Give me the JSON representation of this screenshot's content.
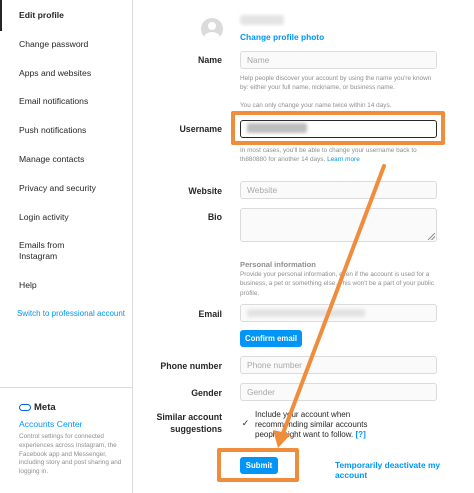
{
  "sidebar": {
    "items": [
      {
        "label": "Edit profile"
      },
      {
        "label": "Change password"
      },
      {
        "label": "Apps and websites"
      },
      {
        "label": "Email notifications"
      },
      {
        "label": "Push notifications"
      },
      {
        "label": "Manage contacts"
      },
      {
        "label": "Privacy and security"
      },
      {
        "label": "Login activity"
      },
      {
        "label": "Emails from Instagram"
      },
      {
        "label": "Help"
      }
    ],
    "switch_professional": "Switch to professional account",
    "meta_label": "Meta",
    "accounts_center": "Accounts Center",
    "accounts_center_desc": "Control settings for connected experiences across Instagram, the Facebook app and Messenger, including story and post sharing and logging in."
  },
  "profile": {
    "change_photo": "Change profile photo"
  },
  "form": {
    "name": {
      "label": "Name",
      "placeholder": "Name",
      "help_1": "Help people discover your account by using the name you're known by: either your full name, nickname, or business name.",
      "help_2": "You can only change your name twice within 14 days."
    },
    "username": {
      "label": "Username",
      "help_1": "In most cases, you'll be able to change your username back to th880880 for another 14 days.",
      "help_link": "Learn more"
    },
    "website": {
      "label": "Website",
      "placeholder": "Website"
    },
    "bio": {
      "label": "Bio"
    },
    "personal_info": {
      "title": "Personal information",
      "help": "Provide your personal information, even if the account is used for a business, a pet or something else. This won't be a part of your public profile."
    },
    "email": {
      "label": "Email",
      "confirm_button": "Confirm email"
    },
    "phone": {
      "label": "Phone number",
      "placeholder": "Phone number"
    },
    "gender": {
      "label": "Gender",
      "placeholder": "Gender"
    },
    "similar": {
      "label_line1": "Similar account",
      "label_line2": "suggestions",
      "text": "Include your account when recommending similar accounts people might want to follow.",
      "qmark": "[?]",
      "checked_glyph": "✓"
    },
    "submit": "Submit",
    "deactivate": "Temporarily deactivate my account"
  },
  "annotations": {
    "color": "#f08d3c"
  }
}
